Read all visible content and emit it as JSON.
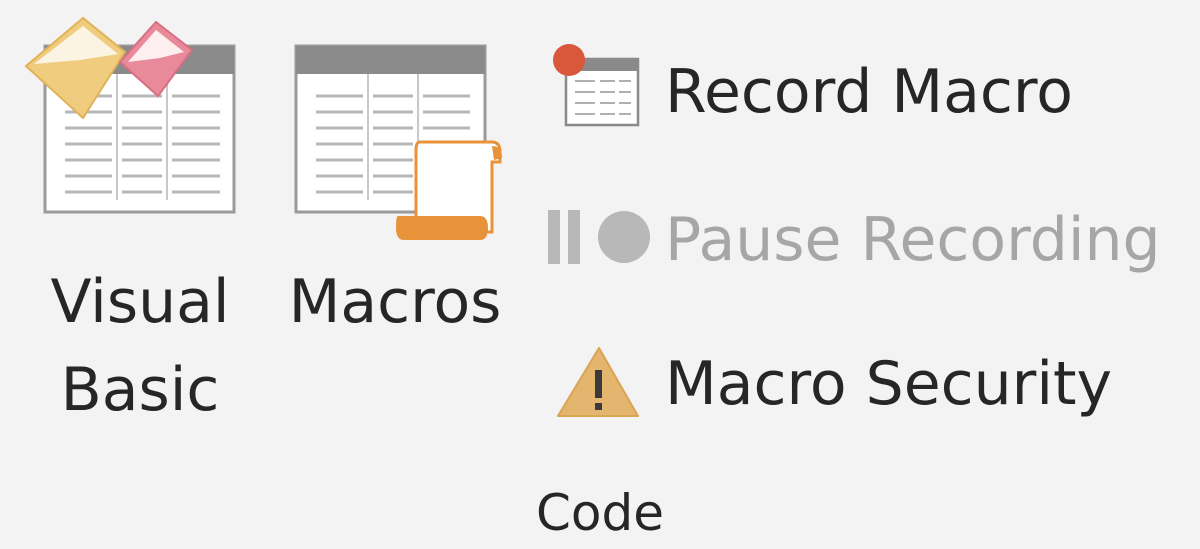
{
  "ribbon": {
    "group_name": "Code",
    "large_buttons": {
      "visual_basic": {
        "label_line1": "Visual",
        "label_line2": "Basic",
        "icon": "visual-basic-icon"
      },
      "macros": {
        "label": "Macros",
        "icon": "macros-icon"
      }
    },
    "small_buttons": {
      "record_macro": {
        "label": "Record Macro",
        "icon": "record-macro-icon",
        "enabled": true
      },
      "pause_recording": {
        "label": "Pause Recording",
        "icon": "pause-recording-icon",
        "enabled": false
      },
      "macro_security": {
        "label": "Macro Security",
        "icon": "warning-icon",
        "enabled": true
      }
    }
  },
  "colors": {
    "background": "#f3f3f3",
    "text": "#262626",
    "disabled_text": "#a6a6a6",
    "record_red": "#d9573b",
    "warning_amber": "#e4b56e",
    "scroll_orange": "#e8923a",
    "vb_gold": "#f0cc7e",
    "vb_pink": "#e98a9b"
  }
}
